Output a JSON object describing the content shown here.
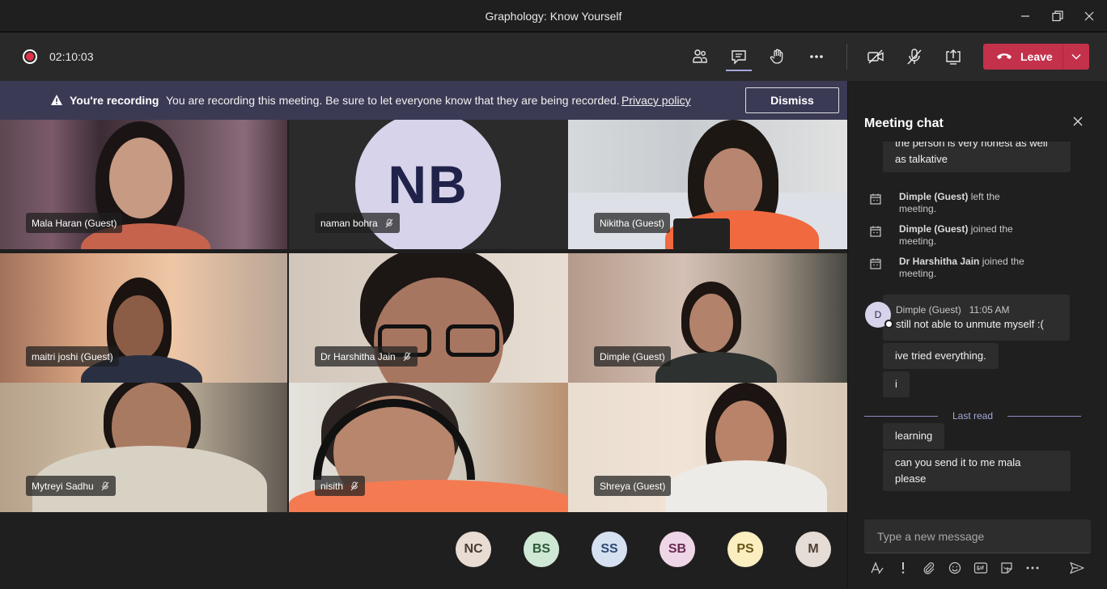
{
  "window": {
    "title": "Graphology: Know Yourself"
  },
  "controls": {
    "timer": "02:10:03",
    "leave_label": "Leave"
  },
  "banner": {
    "title": "You're recording",
    "text": "You are recording this meeting. Be sure to let everyone know that they are being recorded.",
    "link": "Privacy policy",
    "dismiss": "Dismiss"
  },
  "tiles": [
    {
      "name": "Mala Haran (Guest)",
      "muted": false
    },
    {
      "name": "naman bohra",
      "muted": true,
      "initials": "NB"
    },
    {
      "name": "Nikitha (Guest)",
      "muted": false
    },
    {
      "name": "maitri joshi (Guest)",
      "muted": false
    },
    {
      "name": "Dr Harshitha Jain",
      "muted": true
    },
    {
      "name": "Dimple (Guest)",
      "muted": false
    },
    {
      "name": "Mytreyi Sadhu",
      "muted": true
    },
    {
      "name": "nisith",
      "muted": true
    },
    {
      "name": "Shreya (Guest)",
      "muted": false
    }
  ],
  "roster": [
    {
      "initials": "NC",
      "bg": "#e8dcd3",
      "fg": "#4a3d33"
    },
    {
      "initials": "BS",
      "bg": "#cfe8d5",
      "fg": "#2c5a36"
    },
    {
      "initials": "SS",
      "bg": "#d5e0f0",
      "fg": "#2d4a74"
    },
    {
      "initials": "SB",
      "bg": "#efd6e6",
      "fg": "#6a2b55"
    },
    {
      "initials": "PS",
      "bg": "#fbeebf",
      "fg": "#6b5518"
    },
    {
      "initials": "M",
      "bg": "#e5dcd5",
      "fg": "#4d3f35"
    }
  ],
  "chat": {
    "title": "Meeting chat",
    "partial_bubble": "the person is very honest as well as talkative",
    "partial_line1": "the person is very honest as well",
    "partial_line2": "as talkative",
    "events": [
      {
        "who": "Dimple (Guest)",
        "action": "left the",
        "cont": "meeting."
      },
      {
        "who": "Dimple (Guest)",
        "action": "joined the",
        "cont": "meeting."
      },
      {
        "who": "Dr Harshitha Jain",
        "action": "joined the",
        "cont": "meeting."
      }
    ],
    "sender": "Dimple (Guest)",
    "sender_initial": "D",
    "time": "11:05 AM",
    "messages": [
      "still not able to unmute myself :(",
      "ive tried everything.",
      "i"
    ],
    "last_read": "Last read",
    "after": [
      "learning"
    ],
    "last_line1": "can you send it to me mala",
    "last_line2": "please",
    "placeholder": "Type a new message"
  }
}
